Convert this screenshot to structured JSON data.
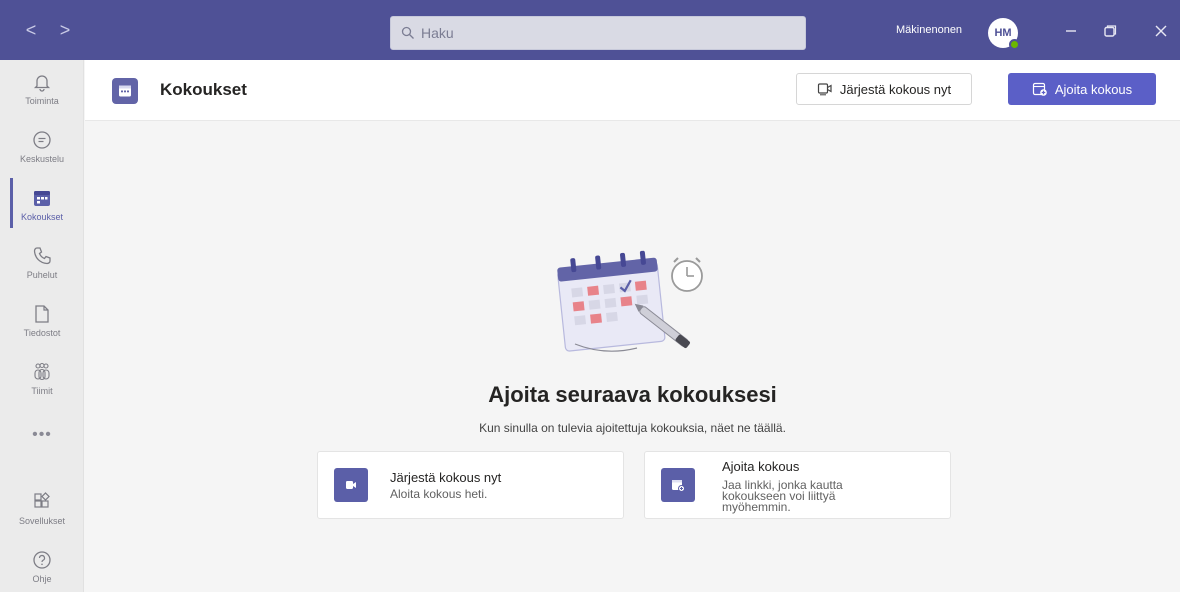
{
  "titlebar": {
    "back_label": "<",
    "forward_label": ">",
    "search_placeholder": "Haku",
    "username": "Mäkinenonen",
    "avatar_initials": "HM"
  },
  "rail": {
    "items": [
      {
        "label": "Toiminta",
        "icon": "bell-icon"
      },
      {
        "label": "Keskustelu",
        "icon": "chat-icon"
      },
      {
        "label": "Kokoukset",
        "icon": "calendar-icon"
      },
      {
        "label": "Puhelut",
        "icon": "phone-icon"
      },
      {
        "label": "Tiedostot",
        "icon": "file-icon"
      },
      {
        "label": "Tiimit",
        "icon": "teams-icon"
      },
      {
        "label": "Sovellukset",
        "icon": "apps-icon"
      },
      {
        "label": "Ohje",
        "icon": "help-icon"
      }
    ],
    "more_label": "•••",
    "active_index": 2
  },
  "header": {
    "title": "Kokoukset",
    "meet_now_label": "Järjestä kokous nyt",
    "schedule_label": "Ajoita kokous"
  },
  "empty_state": {
    "title": "Ajoita seuraava kokouksesi",
    "subtitle": "Kun sinulla on tulevia ajoitettuja kokouksia, näet ne täällä."
  },
  "cards": [
    {
      "title": "Järjestä kokous nyt",
      "description": "Aloita kokous heti.",
      "icon": "video-icon"
    },
    {
      "title": "Ajoita kokous",
      "description_lines": [
        "Jaa linkki, jonka kautta",
        "kokoukseen voi liittyä",
        "myöhemmin."
      ],
      "icon": "calendar-add-icon"
    }
  ],
  "colors": {
    "titlebar": "#4f5196",
    "accent": "#5b5fc7",
    "rail": "#ebebeb",
    "background": "#f5f5f5"
  }
}
